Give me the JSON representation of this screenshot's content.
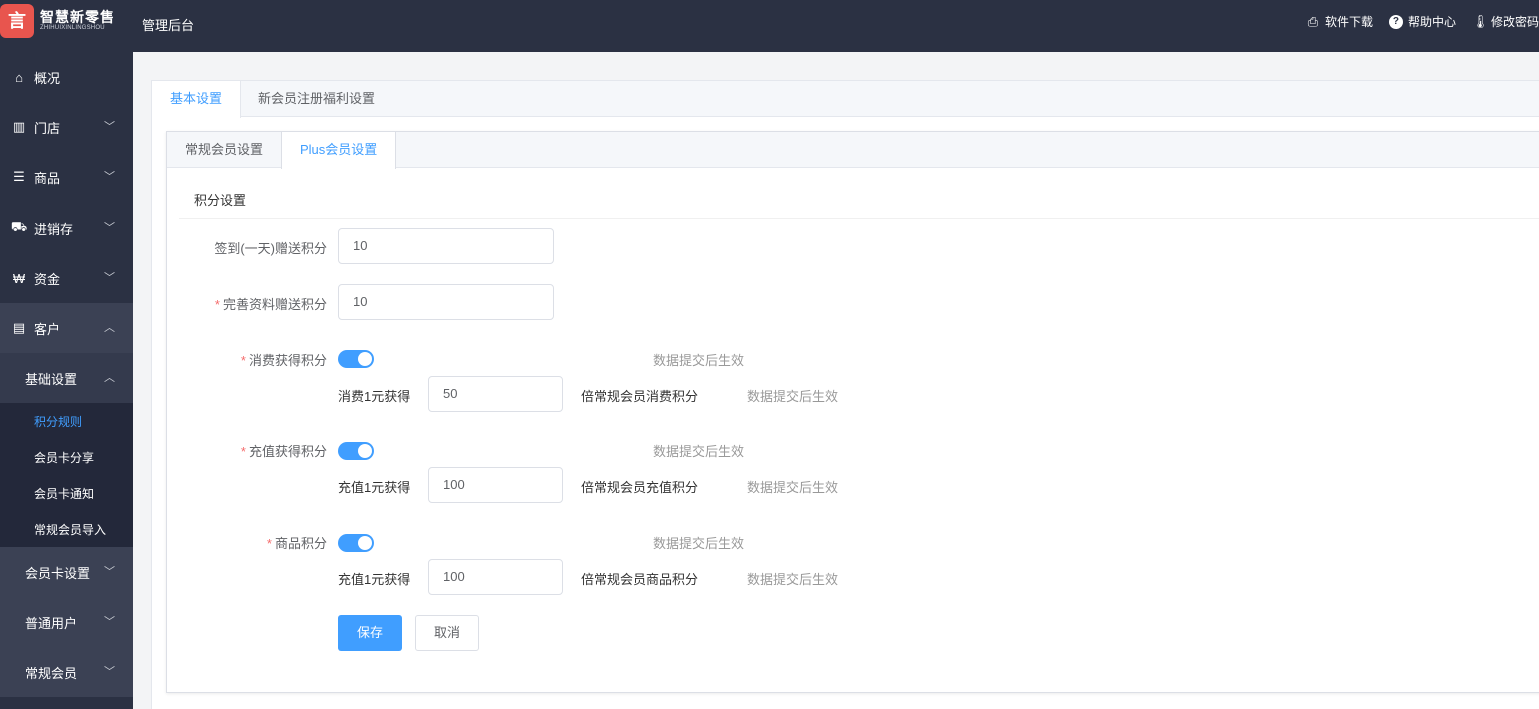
{
  "header": {
    "logo_mark": "言",
    "logo_text": "智慧新零售",
    "logo_subtext": "ZHIHUIXINLINGSHOU",
    "app_title": "管理后台",
    "actions": [
      {
        "label": "软件下载",
        "icon": "printer-icon"
      },
      {
        "label": "帮助中心",
        "icon": "help-circle-icon"
      },
      {
        "label": "修改密码",
        "icon": "thermometer-icon"
      }
    ]
  },
  "sidebar": {
    "items": [
      {
        "label": "概况",
        "icon": "home-icon"
      },
      {
        "label": "门店",
        "icon": "building-icon"
      },
      {
        "label": "商品",
        "icon": "list-icon"
      },
      {
        "label": "进销存",
        "icon": "truck-icon"
      },
      {
        "label": "资金",
        "icon": "won-icon"
      },
      {
        "label": "客户",
        "icon": "id-card-icon"
      }
    ],
    "submenu_title": "基础设置",
    "submenu_items": [
      "积分规则",
      "会员卡分享",
      "会员卡通知",
      "常规会员导入"
    ],
    "more_items": [
      "会员卡设置",
      "普通用户",
      "常规会员"
    ]
  },
  "tabs_outer": [
    "基本设置",
    "新会员注册福利设置"
  ],
  "tabs_inner": [
    "常规会员设置",
    "Plus会员设置"
  ],
  "form": {
    "section_title": "积分设置",
    "checkin_label": "签到(一天)赠送积分",
    "checkin_value": "10",
    "profile_label": "完善资料赠送积分",
    "profile_value": "10",
    "consume": {
      "label": "消费获得积分",
      "hint": "数据提交后生效",
      "rate_prefix": "消费1元获得",
      "rate_value": "50",
      "rate_suffix": "倍常规会员消费积分",
      "rate_hint": "数据提交后生效"
    },
    "recharge": {
      "label": "充值获得积分",
      "hint": "数据提交后生效",
      "rate_prefix": "充值1元获得",
      "rate_value": "100",
      "rate_suffix": "倍常规会员充值积分",
      "rate_hint": "数据提交后生效"
    },
    "goods": {
      "label": "商品积分",
      "hint": "数据提交后生效",
      "rate_prefix": "充值1元获得",
      "rate_value": "100",
      "rate_suffix": "倍常规会员商品积分",
      "rate_hint": "数据提交后生效"
    },
    "save_label": "保存",
    "cancel_label": "取消"
  },
  "colors": {
    "sidebar_bg": "#2b3143",
    "accent": "#409eff",
    "required": "#f56c6c"
  }
}
